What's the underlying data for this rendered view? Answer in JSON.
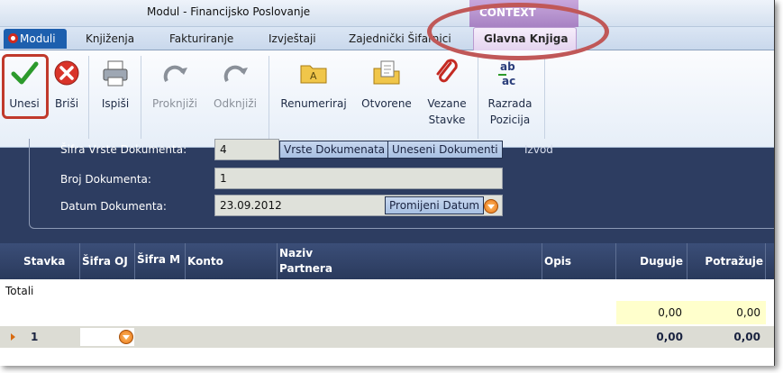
{
  "title": "Modul - Financijsko Poslovanje",
  "context_label": "CONTEXT",
  "moduli_label": "Moduli",
  "tabs": [
    "Knjiženja",
    "Fakturiranje",
    "Izvještaji",
    "Zajednički Šifarnici"
  ],
  "active_tab": "Glavna Knjiga",
  "ribbon": {
    "unesi": "Unesi",
    "brisi": "Briši",
    "ispisi": "Ispiši",
    "proknjizi": "Proknjiži",
    "odknjizi": "Odknjiži",
    "renumeriraj": "Renumeriraj",
    "otvorene": "Otvorene",
    "vezane_1": "Vezane",
    "vezane_2": "Stavke",
    "razrada_1": "Razrada",
    "razrada_2": "Pozicija"
  },
  "form": {
    "sifra_label": "Šifra Vrste Dokumenta:",
    "sifra_value": "4",
    "vrste_btn": "Vrste Dokumenata",
    "uneseni_btn": "Uneseni Dokumenti",
    "izvod": "Izvod",
    "broj_label": "Broj Dokumenta:",
    "broj_value": "1",
    "datum_label": "Datum Dokumenta:",
    "datum_value": "23.09.2012",
    "promijeni_btn": "Promijeni Datum"
  },
  "grid": {
    "columns": [
      "Stavka",
      "Šifra OJ",
      "Šifra M",
      "Konto",
      "Naziv",
      "Partnera",
      "Opis",
      "Duguje",
      "Potražuje"
    ],
    "totali_label": "Totali",
    "totals": {
      "duguje": "0,00",
      "potrazuje": "0,00"
    },
    "rows": [
      {
        "stavka": "1",
        "duguje": "0,00",
        "potrazuje": "0,00"
      }
    ]
  },
  "colors": {
    "ribbon_accent": "#1d5fae",
    "context_purple": "#a782c3",
    "form_background": "#2d3d61",
    "highlight_red": "#c0392b"
  }
}
